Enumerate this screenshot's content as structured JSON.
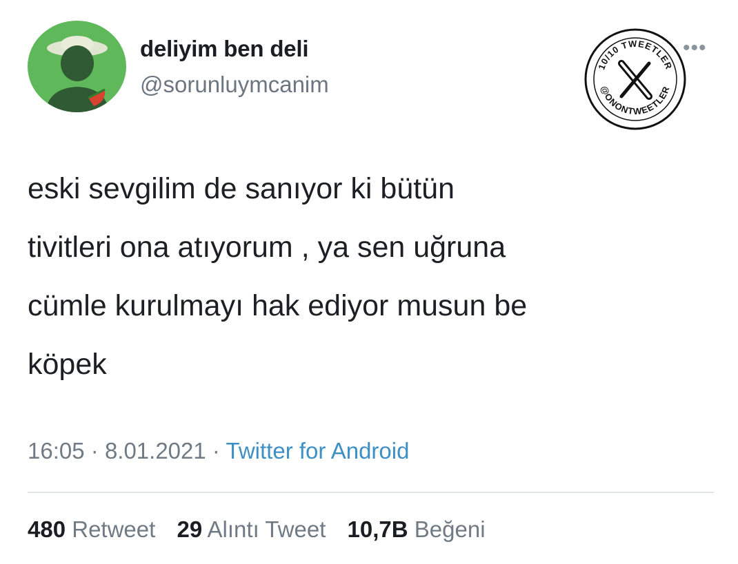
{
  "user": {
    "display_name": "deliyim ben deli",
    "handle": "@sorunluymcanim"
  },
  "tweet": {
    "lines": [
      "eski sevgilim de sanıyor ki bütün",
      "tivitleri ona atıyorum , ya sen uğruna",
      "cümle kurulmayı hak ediyor musun be",
      "köpek"
    ]
  },
  "meta": {
    "time": "16:05",
    "separator": "·",
    "date": "8.01.2021",
    "source": "Twitter for Android"
  },
  "stats": {
    "retweets": {
      "count": "480",
      "label": "Retweet"
    },
    "quotes": {
      "count": "29",
      "label": "Alıntı Tweet"
    },
    "likes": {
      "count": "10,7B",
      "label": "Beğeni"
    }
  },
  "more_icon": "•••",
  "watermark": {
    "top_text": "10/10 TWEETLER",
    "bottom_text": "@ONONTWEETLER",
    "logo": "X"
  },
  "colors": {
    "avatar_bg": "#5fb85a",
    "source_link": "#3d8fc4",
    "muted_text": "#6f7a84"
  }
}
